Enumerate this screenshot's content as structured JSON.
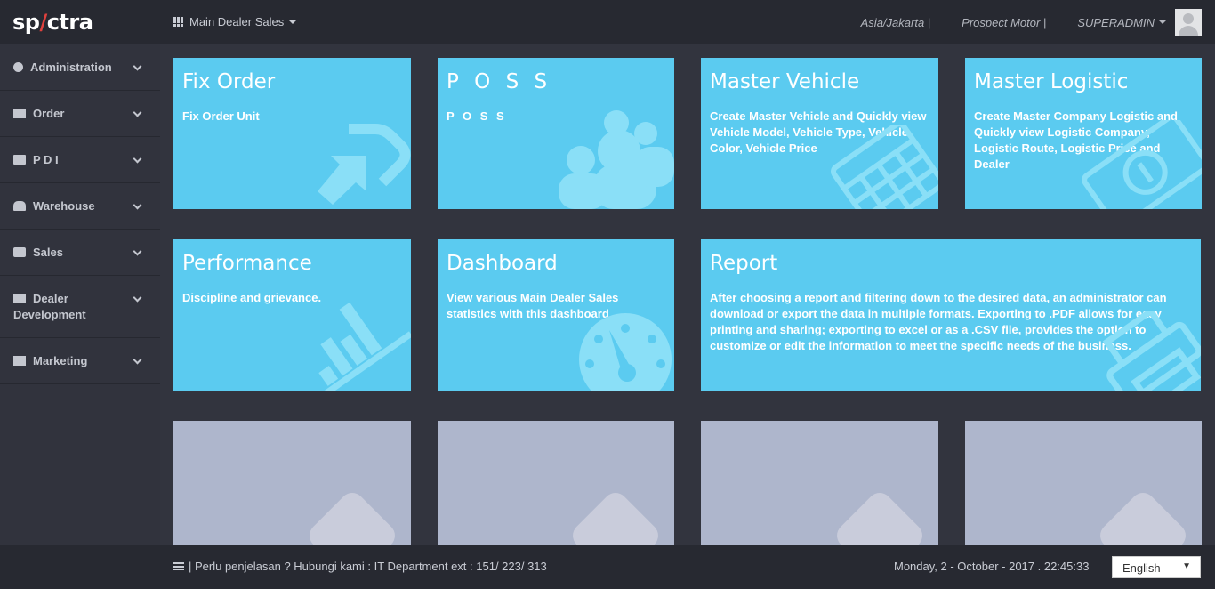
{
  "header": {
    "logo_prefix": "sp",
    "logo_slash": "/",
    "logo_suffix": "ctra",
    "app_switcher_label": "Main Dealer Sales",
    "timezone": "Asia/Jakarta |",
    "company": "Prospect Motor |",
    "user": "SUPERADMIN"
  },
  "sidebar": {
    "items": [
      {
        "label": "Administration",
        "icon": "gear-icon"
      },
      {
        "label": "Order",
        "icon": "sign-in-icon"
      },
      {
        "label": "P D I",
        "icon": "calendar-icon"
      },
      {
        "label": "Warehouse",
        "icon": "users-icon"
      },
      {
        "label": "Sales",
        "icon": "briefcase-icon"
      },
      {
        "label": "Dealer Development",
        "icon": "bar-chart-icon"
      },
      {
        "label": "Marketing",
        "icon": "bar-chart-icon"
      }
    ]
  },
  "tiles": [
    {
      "title": "Fix Order",
      "desc": "Fix Order Unit",
      "icon": "share-icon"
    },
    {
      "title": "P O S S",
      "desc": "P O S S",
      "icon": "users-icon"
    },
    {
      "title": "Master Vehicle",
      "desc": "Create Master Vehicle and Quickly view Vehicle Model, Vehicle Type, Vehicle Color, Vehicle Price",
      "icon": "calendar-icon"
    },
    {
      "title": "Master Logistic",
      "desc": "Create Master Company Logistic and Quickly view Logistic Company, Logistic Route, Logistic Price and Dealer",
      "icon": "money-icon"
    },
    {
      "title": "Performance",
      "desc": "Discipline and grievance.",
      "icon": "bar-chart-icon"
    },
    {
      "title": "Dashboard",
      "desc": "View various Main Dealer Sales statistics with this dashboard",
      "icon": "dashboard-icon"
    },
    {
      "title": "Report",
      "desc": "After choosing a report and filtering down to the desired data, an administrator can download or export the data in multiple formats. Exporting to .PDF allows for easy printing and sharing; exporting to excel or as a .CSV file, provides the option to customize or edit the information to meet the specific needs of the business.",
      "icon": "print-icon"
    }
  ],
  "footer": {
    "help_text": "| Perlu penjelasan ? Hubungi kami : IT Department ext : 151/ 223/ 313",
    "datetime": "Monday, 2 - October - 2017 . 22:45:33",
    "language": "English"
  },
  "colors": {
    "tile": "#5bcbf0",
    "tile_empty": "#aeb6cc",
    "header": "#272931",
    "sidebar": "#31333d",
    "logo_accent": "#e0413d"
  }
}
